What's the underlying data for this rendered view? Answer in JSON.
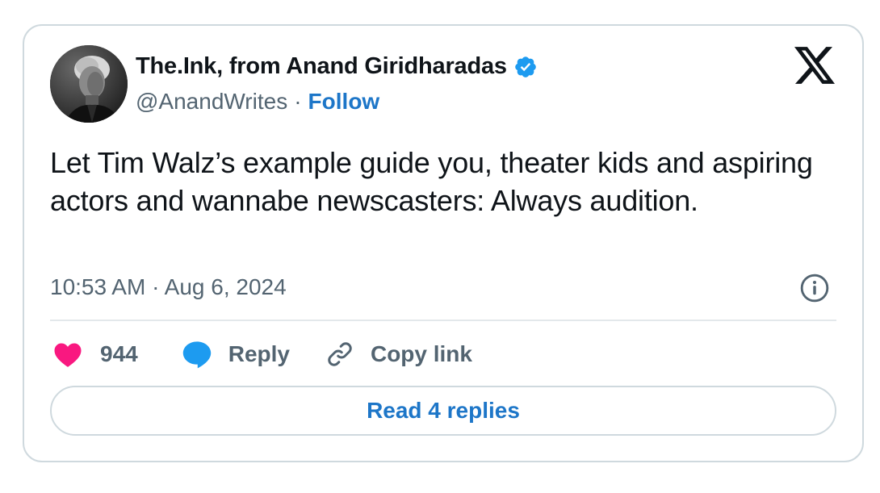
{
  "author": {
    "name": "The.Ink, from Anand Giridharadas",
    "handle": "@AnandWrites",
    "separator": "·",
    "follow_label": "Follow",
    "verified": true,
    "verified_color": "#1d9bf0"
  },
  "tweet": {
    "text": "Let Tim Walz’s example guide you, theater kids and aspiring actors and wannabe newscasters: Always audition.",
    "timestamp": "10:53 AM · Aug 6, 2024"
  },
  "actions": {
    "like_count": "944",
    "reply_label": "Reply",
    "copy_label": "Copy link"
  },
  "read_replies_label": "Read 4 replies",
  "icons": {
    "logo": "x-logo-icon",
    "info": "info-icon",
    "like": "heart-icon",
    "reply": "speech-bubble-icon",
    "copy": "link-icon",
    "verified": "verified-badge-icon"
  },
  "colors": {
    "link": "#1d76c8",
    "heart": "#f91880",
    "reply_bubble": "#1d9bf0",
    "muted_text": "#536471",
    "border": "#cfd9de"
  }
}
